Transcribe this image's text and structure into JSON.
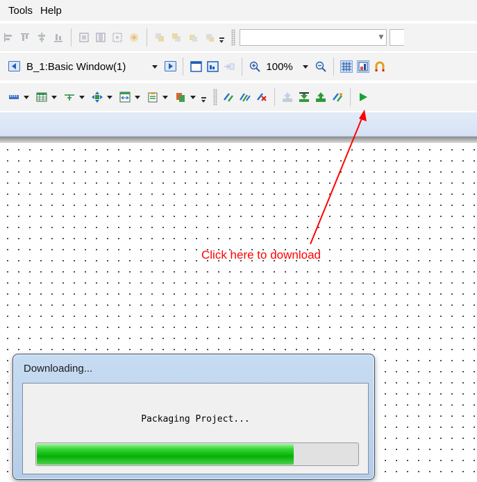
{
  "menu": {
    "items": [
      "Tools",
      "Help"
    ]
  },
  "toolbar_window": {
    "window_label": "B_1:Basic Window(1)",
    "zoom_value": "100%"
  },
  "canvas": {
    "annotation_text": "Click here to download",
    "annotation_color": "#ff0000"
  },
  "dialog": {
    "title": "Downloading...",
    "message": "Packaging Project...",
    "progress_fraction": 0.8,
    "progress_color": "#06b006"
  },
  "icons": [
    "align-left-icon",
    "align-top-icon",
    "align-center-icon",
    "align-bottom-icon",
    "nav-prev-window-icon",
    "nav-next-window-icon",
    "zoom-in-icon",
    "zoom-out-icon",
    "grid-icon",
    "snap-icon",
    "compile-icon",
    "download-icon",
    "upload-icon",
    "run-simulation-icon"
  ]
}
